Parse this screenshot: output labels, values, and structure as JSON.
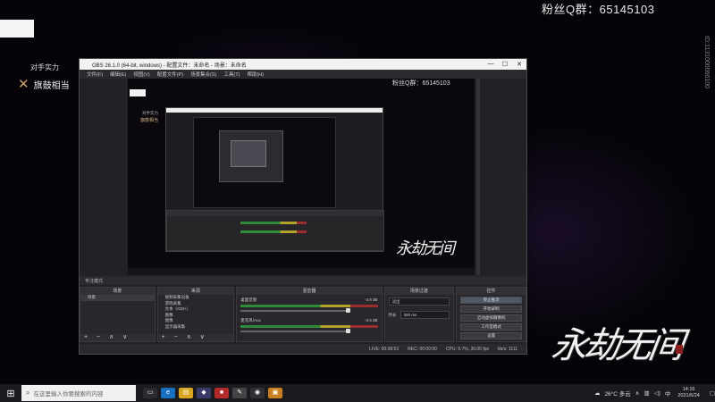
{
  "overlay": {
    "fan_qq": "粉丝Q群：65145103",
    "side_id": "ID:1131000060100",
    "opponent_label": "对手实力",
    "opponent_name": "旗鼓相当",
    "game_logo": "永劫无间"
  },
  "obs": {
    "title": "OBS 26.1.0 (64-bit, windows) - 配置文件：未命名 - 场景：未命名",
    "menu": [
      "文件(F)",
      "编辑(E)",
      "视图(V)",
      "配置文件(P)",
      "场景集合(S)",
      "工具(T)",
      "帮助(H)"
    ],
    "preview_qq": "粉丝Q群：65145103",
    "preview_label1": "对手实力",
    "preview_label2": "旗鼓相当",
    "preview_logo": "永劫无间",
    "stats_label": "专注模式",
    "docks": {
      "scenes": {
        "title": "场景",
        "items": [
          "场景"
        ]
      },
      "sources": {
        "title": "来源",
        "items": [
          "视频采集设备",
          "游戏采集",
          "文本（GDI+）",
          "图像",
          "图像",
          "显示器采集"
        ]
      },
      "mixer": {
        "title": "混音器",
        "channels": [
          {
            "name": "桌面音频",
            "db": "-3.9 dB"
          },
          {
            "name": "麦克风/Aux",
            "db": "-3.9 dB"
          }
        ]
      },
      "transitions": {
        "title": "场景过渡",
        "type": "淡出",
        "duration_label": "时长",
        "duration": "300 ms"
      },
      "controls": {
        "title": "控件",
        "buttons": [
          "停止推流",
          "开始录制",
          "启动虚拟摄像机",
          "工作室模式",
          "设置",
          "退出"
        ]
      },
      "foot_icons": "+ − ∧ ∨"
    },
    "status": {
      "live": "LIVE: 00:08:53",
      "rec": "REC: 00:00:00",
      "cpu": "CPU: 9.7%, 30.00 fps",
      "kbps": "kb/s: 1111"
    }
  },
  "taskbar": {
    "search_placeholder": "在这里输入你要搜索的内容",
    "weather": "26°C 多云",
    "ime": "中",
    "time": "14:16",
    "date": "2021/6/24"
  }
}
